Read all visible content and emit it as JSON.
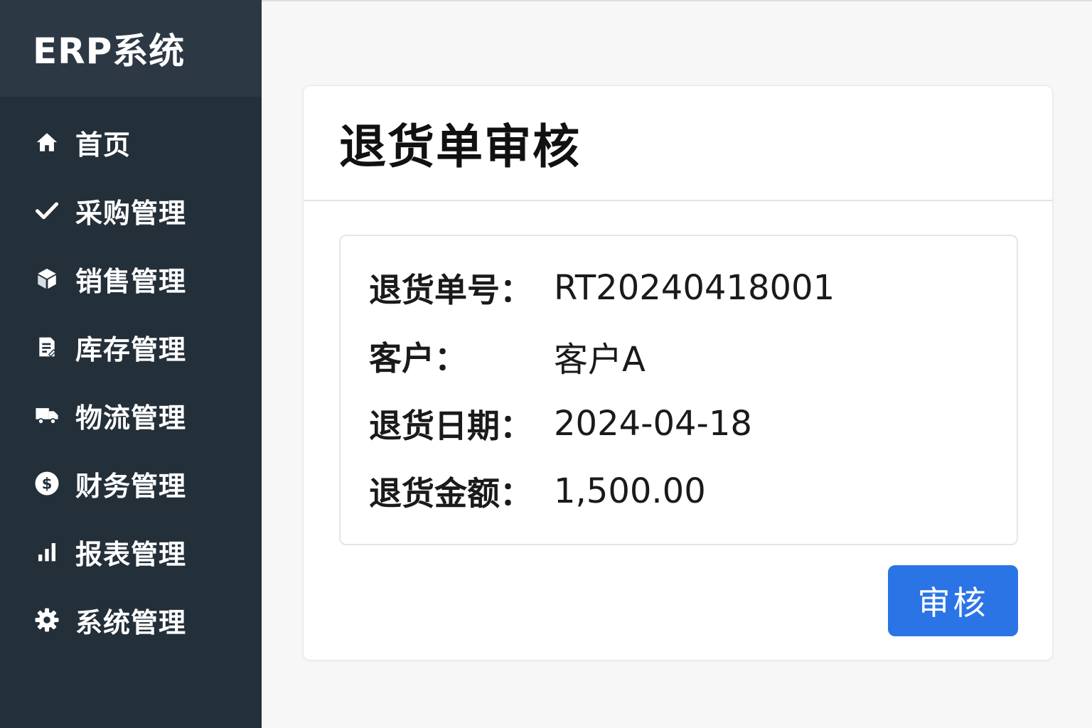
{
  "sidebar": {
    "brand": "ERP系统",
    "items": [
      {
        "label": "首页",
        "icon": "home-icon"
      },
      {
        "label": "采购管理",
        "icon": "check-icon"
      },
      {
        "label": "销售管理",
        "icon": "box-icon"
      },
      {
        "label": "库存管理",
        "icon": "document-icon"
      },
      {
        "label": "物流管理",
        "icon": "truck-icon"
      },
      {
        "label": "财务管理",
        "icon": "dollar-icon"
      },
      {
        "label": "报表管理",
        "icon": "bar-chart-icon"
      },
      {
        "label": "系统管理",
        "icon": "gear-icon"
      }
    ]
  },
  "main": {
    "title": "退货单审核",
    "details": [
      {
        "label": "退货单号：",
        "value": "RT20240418001"
      },
      {
        "label": "客户：",
        "value": "客户A"
      },
      {
        "label": "退货日期：",
        "value": "2024-04-18"
      },
      {
        "label": "退货金额：",
        "value": "1,500.00"
      }
    ],
    "approve_label": "审核"
  },
  "colors": {
    "sidebar_bg": "#232f39",
    "brand_bg": "#2c3844",
    "accent": "#2b74e6",
    "page_bg": "#f7f7f8"
  }
}
